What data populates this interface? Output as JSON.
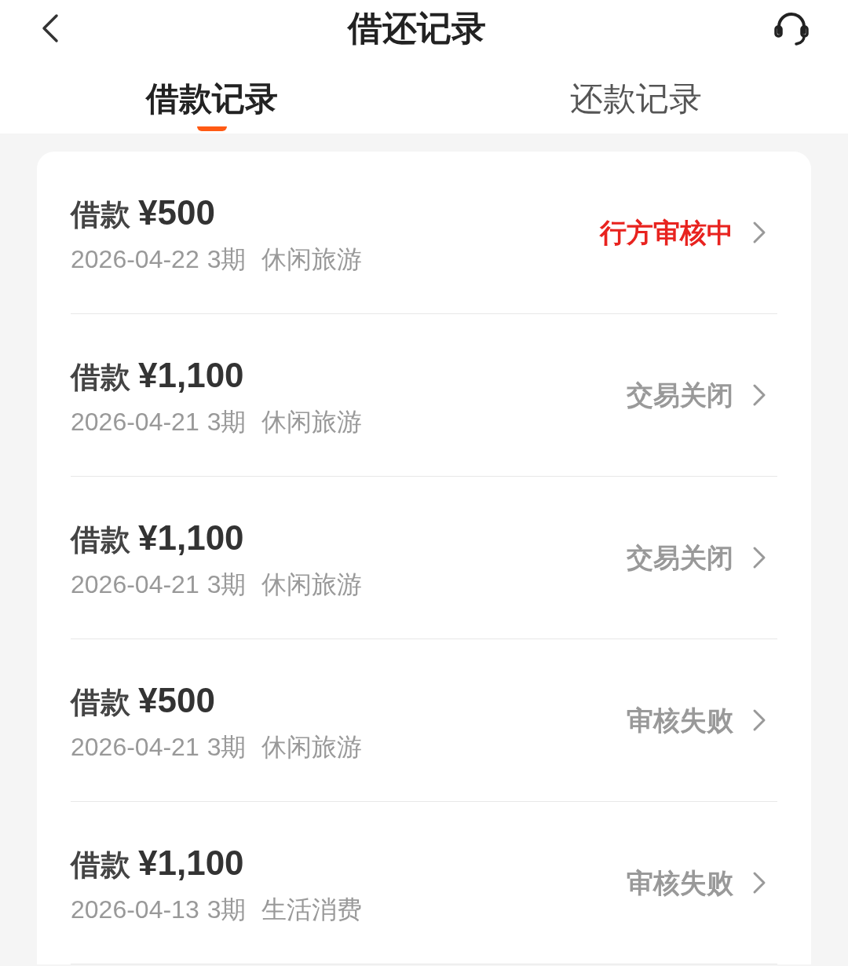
{
  "header": {
    "title": "借还记录"
  },
  "tabs": [
    {
      "label": "借款记录",
      "selected": true
    },
    {
      "label": "还款记录",
      "selected": false
    }
  ],
  "records": [
    {
      "label": "借款",
      "amount": "¥500",
      "date": "2026-04-22",
      "term": "3期",
      "purpose": "休闲旅游",
      "status": "行方审核中",
      "color": "#e8231f"
    },
    {
      "label": "借款",
      "amount": "¥1,100",
      "date": "2026-04-21",
      "term": "3期",
      "purpose": "休闲旅游",
      "status": "交易关闭",
      "color": "#999999"
    },
    {
      "label": "借款",
      "amount": "¥1,100",
      "date": "2026-04-21",
      "term": "3期",
      "purpose": "休闲旅游",
      "status": "交易关闭",
      "color": "#999999"
    },
    {
      "label": "借款",
      "amount": "¥500",
      "date": "2026-04-21",
      "term": "3期",
      "purpose": "休闲旅游",
      "status": "审核失败",
      "color": "#999999"
    },
    {
      "label": "借款",
      "amount": "¥1,100",
      "date": "2026-04-13",
      "term": "3期",
      "purpose": "生活消费",
      "status": "审核失败",
      "color": "#999999"
    }
  ]
}
